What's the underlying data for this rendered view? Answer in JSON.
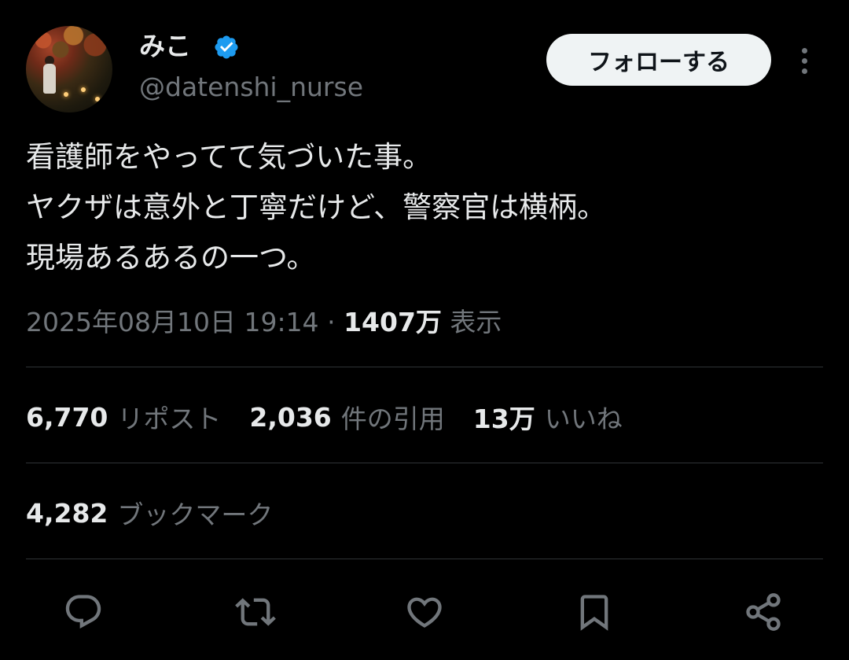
{
  "author": {
    "display_name": "みこ",
    "handle": "@datenshi_nurse",
    "verified": true
  },
  "follow_button_label": "フォローする",
  "tweet": {
    "lines": [
      "看護師をやってて気づいた事。",
      "ヤクザは意外と丁寧だけど、警察官は横柄。",
      "現場あるあるの一つ。"
    ]
  },
  "meta": {
    "timestamp": "2025年08月10日 19:14",
    "separator": "·",
    "views_count": "1407万",
    "views_label": "表示"
  },
  "stats": {
    "reposts": {
      "count": "6,770",
      "label": "リポスト"
    },
    "quotes": {
      "count": "2,036",
      "label": "件の引用"
    },
    "likes": {
      "count": "13万",
      "label": "いいね"
    },
    "bookmarks": {
      "count": "4,282",
      "label": "ブックマーク"
    }
  },
  "actions": [
    "reply-icon",
    "repost-icon",
    "like-icon",
    "bookmark-icon",
    "share-icon"
  ],
  "colors": {
    "background": "#000000",
    "primary_text": "#e7e9ea",
    "secondary_text": "#71767b",
    "divider": "#2f3336",
    "verified_badge": "#1d9bf0",
    "follow_button_bg": "#eff3f4"
  }
}
